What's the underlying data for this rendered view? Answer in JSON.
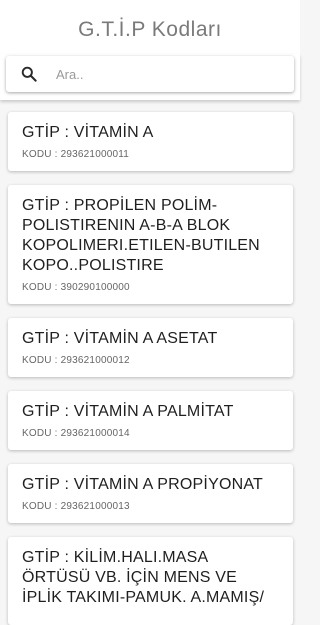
{
  "header": {
    "title": "G.T.İ.P Kodları"
  },
  "search": {
    "placeholder": "Ara..",
    "icon": "search-icon"
  },
  "items": [
    {
      "title": "GTİP : VİTAMİN A",
      "code": "KODU : 293621000011"
    },
    {
      "title": "GTİP : PROPİLEN POLİM-POLISTIRENIN A-B-A BLOK KOPOLIMERI.ETILEN-BUTILEN KOPO..POLISTIRE",
      "code": "KODU : 390290100000"
    },
    {
      "title": "GTİP : VİTAMİN A ASETAT",
      "code": "KODU : 293621000012"
    },
    {
      "title": "GTİP : VİTAMİN A PALMİTAT",
      "code": "KODU : 293621000014"
    },
    {
      "title": "GTİP : VİTAMİN A PROPİYONAT",
      "code": "KODU : 293621000013"
    },
    {
      "title": "GTİP : KİLİM.HALI.MASA ÖRTÜSÜ VB. İÇİN MENS VE İPLİK TAKIMI-PAMUK. A.MAMIŞ/",
      "code": ""
    }
  ]
}
